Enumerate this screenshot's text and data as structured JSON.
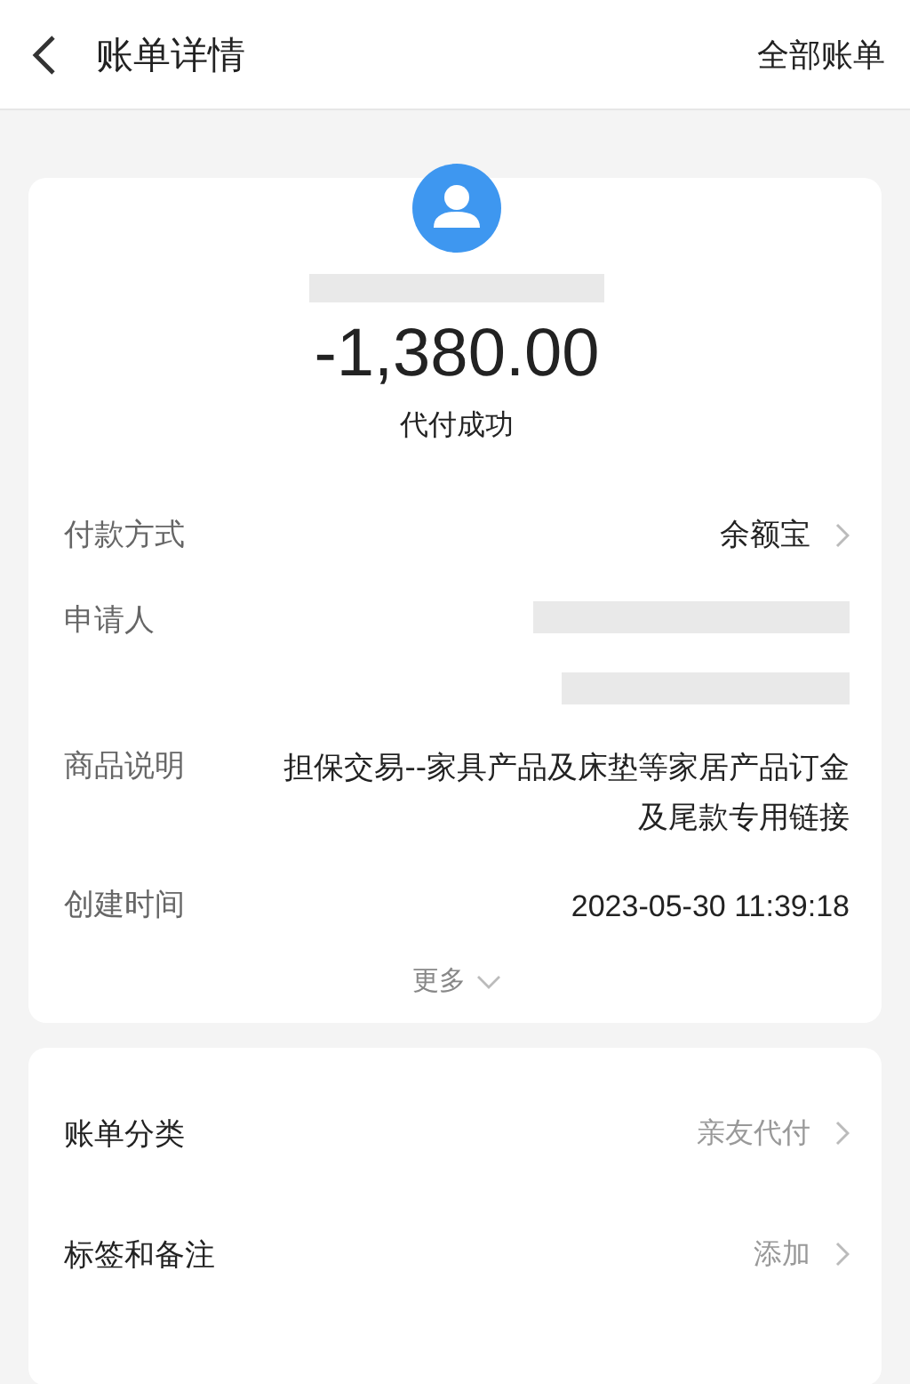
{
  "header": {
    "title": "账单详情",
    "action": "全部账单"
  },
  "summary": {
    "amount": "-1,380.00",
    "status": "代付成功"
  },
  "details": [
    {
      "kind": "link",
      "label": "付款方式",
      "value": "余额宝"
    },
    {
      "kind": "redacted",
      "label": "申请人"
    },
    {
      "kind": "text",
      "label": "商品说明",
      "value": "担保交易--家具产品及床垫等家居产品订金及尾款专用链接"
    },
    {
      "kind": "text",
      "label": "创建时间",
      "value": "2023-05-30 11:39:18"
    }
  ],
  "more": "更多",
  "extras": [
    {
      "label": "账单分类",
      "value": "亲友代付"
    },
    {
      "label": "标签和备注",
      "value": "添加"
    }
  ]
}
